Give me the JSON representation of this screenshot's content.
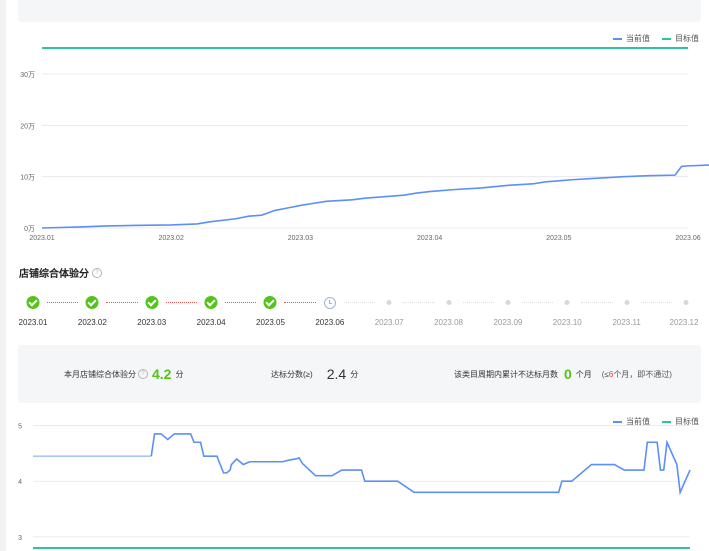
{
  "legend_top": {
    "current": "当前值",
    "target": "目标值"
  },
  "legend_bottom": {
    "current": "当前值",
    "target": "目标值"
  },
  "colors": {
    "current": "#5b8ff9",
    "target": "#2fc39b",
    "pass": "#52c41a",
    "fail": "#e23c3c"
  },
  "score_section": {
    "title": "店铺综合体验分",
    "help_icon": "question-circle-icon"
  },
  "timeline": [
    {
      "label": "2023.01",
      "status": "done"
    },
    {
      "label": "2023.02",
      "status": "done"
    },
    {
      "label": "2023.03",
      "status": "done"
    },
    {
      "label": "2023.04",
      "status": "done"
    },
    {
      "label": "2023.05",
      "status": "done"
    },
    {
      "label": "2023.06",
      "status": "pending"
    },
    {
      "label": "2023.07",
      "status": "future"
    },
    {
      "label": "2023.08",
      "status": "future"
    },
    {
      "label": "2023.09",
      "status": "future"
    },
    {
      "label": "2023.10",
      "status": "future"
    },
    {
      "label": "2023.11",
      "status": "future"
    },
    {
      "label": "2023.12",
      "status": "future"
    }
  ],
  "summary": {
    "score_label": "本月店铺综合体验分",
    "score_value": "4.2",
    "score_unit": "分",
    "threshold_label": "达标分数(≥)",
    "threshold_value": "2.4",
    "threshold_unit": "分",
    "cycle_label": "该类目周期内累计不达标月数",
    "cycle_value": "0",
    "cycle_unit": "个月",
    "cycle_note_prefix": "(≤",
    "cycle_note_num": "6",
    "cycle_note_suffix": "个月，即不通过)"
  },
  "chart_data": [
    {
      "type": "line",
      "title": "",
      "y_ticks": [
        "0万",
        "10万",
        "20万",
        "30万"
      ],
      "ylim": [
        0,
        30
      ],
      "y_unit": "万",
      "x_ticks": [
        "2023.01",
        "2023.02",
        "2023.03",
        "2023.04",
        "2023.05",
        "2023.06"
      ],
      "grid": true,
      "legend_position": "top-right",
      "series": [
        {
          "name": "当前值",
          "x": [
            0,
            0.3,
            0.5,
            0.7,
            1.0,
            1.2,
            1.3,
            1.5,
            1.6,
            1.7,
            1.8,
            1.9,
            2.0,
            2.1,
            2.2,
            2.4,
            2.5,
            2.6,
            2.7,
            2.8,
            2.9,
            3.0,
            3.2,
            3.4,
            3.6,
            3.8,
            3.9,
            4.0,
            4.1,
            4.3,
            4.5,
            4.7,
            4.9,
            4.95,
            5.0,
            5.2,
            5.4,
            5.6,
            5.8,
            5.9,
            6.0
          ],
          "values": [
            0,
            0.2,
            0.4,
            0.5,
            0.6,
            0.8,
            1.2,
            1.8,
            2.3,
            2.5,
            3.4,
            3.9,
            4.4,
            4.8,
            5.2,
            5.5,
            5.8,
            6.0,
            6.2,
            6.4,
            6.8,
            7.1,
            7.5,
            7.8,
            8.3,
            8.6,
            9.0,
            9.2,
            9.4,
            9.7,
            10.0,
            10.2,
            10.3,
            12.0,
            12.1,
            12.3,
            12.5,
            12.6,
            12.7,
            13.9,
            14.0
          ]
        },
        {
          "name": "目标值",
          "values": []
        }
      ]
    },
    {
      "type": "line",
      "title": "",
      "y_ticks": [
        "3",
        "4",
        "5"
      ],
      "ylim": [
        2.8,
        5.1
      ],
      "grid": true,
      "legend_position": "top-right",
      "series": [
        {
          "name": "当前值",
          "x": [
            0,
            0.03,
            0.18,
            0.185,
            0.195,
            0.205,
            0.215,
            0.23,
            0.24,
            0.245,
            0.255,
            0.26,
            0.27,
            0.28,
            0.29,
            0.295,
            0.3,
            0.302,
            0.31,
            0.32,
            0.33,
            0.35,
            0.38,
            0.39,
            0.4,
            0.405,
            0.41,
            0.43,
            0.45,
            0.455,
            0.47,
            0.5,
            0.505,
            0.55,
            0.555,
            0.58,
            0.59,
            0.61,
            0.8,
            0.805,
            0.81,
            0.82,
            0.85,
            0.88,
            0.885,
            0.9,
            0.93,
            0.935,
            0.95,
            0.955,
            0.96,
            0.965,
            0.98,
            0.985,
            1.0
          ],
          "values": [
            4.45,
            4.45,
            4.45,
            4.85,
            4.85,
            4.75,
            4.85,
            4.85,
            4.85,
            4.7,
            4.7,
            4.45,
            4.45,
            4.45,
            4.15,
            4.15,
            4.2,
            4.3,
            4.4,
            4.3,
            4.35,
            4.35,
            4.35,
            4.38,
            4.4,
            4.42,
            4.32,
            4.1,
            4.1,
            4.1,
            4.2,
            4.2,
            4.0,
            4.0,
            4.0,
            3.8,
            3.8,
            3.8,
            3.8,
            4.0,
            4.0,
            4.0,
            4.3,
            4.3,
            4.3,
            4.2,
            4.2,
            4.7,
            4.7,
            4.2,
            4.2,
            4.7,
            4.3,
            3.8,
            4.2
          ]
        },
        {
          "name": "目标值",
          "values": []
        }
      ]
    }
  ]
}
